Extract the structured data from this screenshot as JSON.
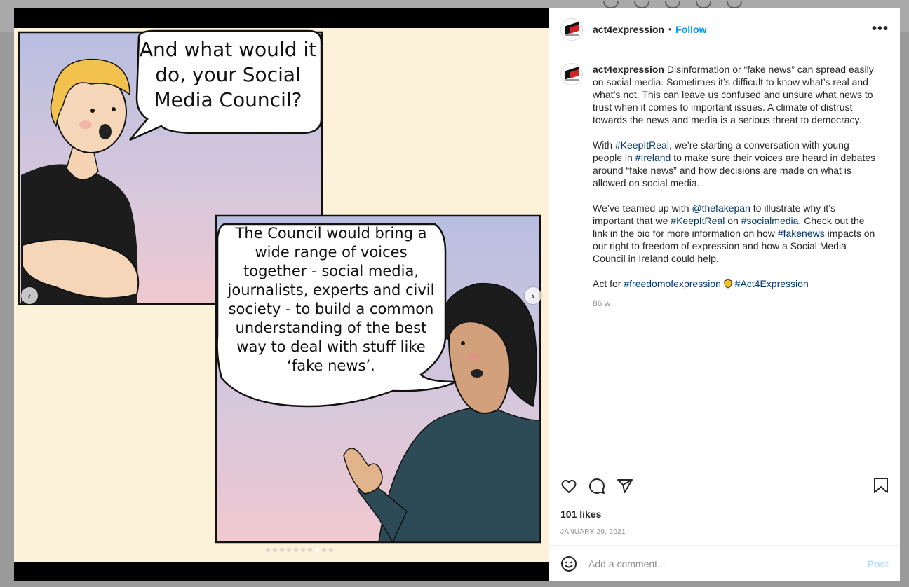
{
  "post": {
    "username": "act4expression",
    "separator": "•",
    "follow_label": "Follow",
    "more_label": "•••",
    "caption": {
      "username": "act4expression",
      "p1": " Disinformation or “fake news” can spread easily on social media. Sometimes it’s difficult to know what’s real and what’s not. This can leave us confused and unsure what news to trust when it comes to important issues. A climate of distrust towards the news and media is a serious threat to democracy.",
      "p2a": "With ",
      "p2_tag1": "#KeepItReal",
      "p2b": ", we’re starting a conversation with young people in ",
      "p2_tag2": "#Ireland",
      "p2c": " to make sure their voices are heard in debates around “fake news” and how decisions are made on what is allowed on social media.",
      "p3a": "We’ve teamed up with ",
      "p3_mention": "@thefakepan",
      "p3b": " to illustrate why it’s important that we ",
      "p3_tag1": "#KeepItReal",
      "p3c": " on ",
      "p3_tag2": "#socialmedia",
      "p3d": ". Check out the link in the bio for more information on how ",
      "p3_tag3": "#fakenews",
      "p3e": " impacts on our right to freedom of expression and how a Social Media Council in Ireland could help.",
      "p4a": "Act for ",
      "p4_tag1": "#freedomofexpression",
      "p4_tag2": "#Act4Expression"
    },
    "age": "86 w",
    "likes": "101 likes",
    "date": "JANUARY 29, 2021",
    "comment_placeholder": "Add a comment...",
    "post_label": "Post"
  },
  "comic": {
    "bubble1": [
      "And what would it",
      "do, your Social",
      "Media Council?"
    ],
    "bubble2": [
      "The Council would bring a",
      "wide range of voices",
      "together - social media,",
      "journalists, experts and civil",
      "society - to build a common",
      "understanding of the best",
      "way to deal with stuff like",
      "‘fake news’."
    ]
  },
  "carousel": {
    "count": 10,
    "active": 7
  },
  "icons": {
    "like": "heart-icon",
    "comment": "comment-icon",
    "share": "paper-plane-icon",
    "save": "bookmark-icon",
    "emoji": "emoji-icon",
    "prev": "chevron-left-icon",
    "next": "chevron-right-icon"
  },
  "colors": {
    "link": "#00376b",
    "follow": "#0095f6",
    "post_disabled": "#b2dffc"
  }
}
